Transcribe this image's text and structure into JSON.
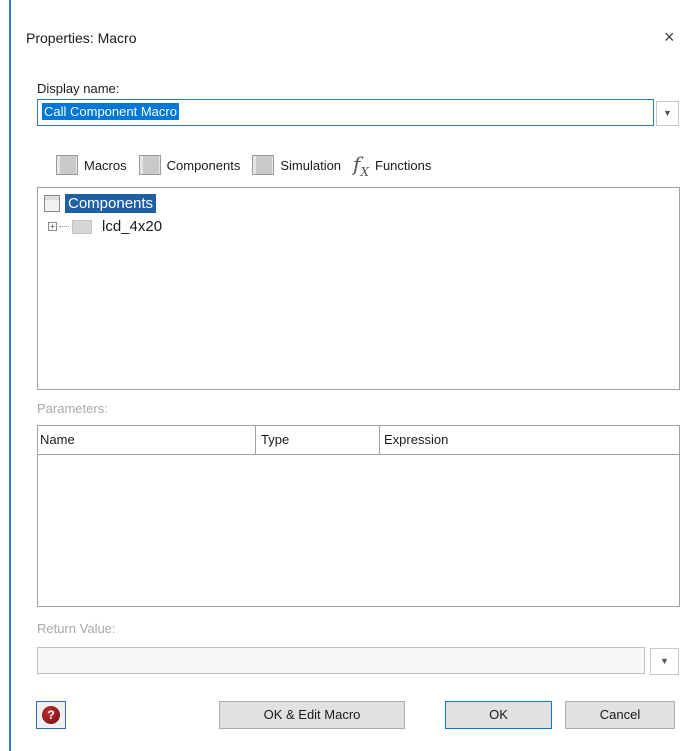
{
  "dialog": {
    "title": "Properties: Macro",
    "close_glyph": "×"
  },
  "display_name": {
    "label": "Display name:",
    "value": "Call Component Macro"
  },
  "tabs": [
    {
      "label": "Macros",
      "icon": "macros-icon"
    },
    {
      "label": "Components",
      "icon": "components-icon"
    },
    {
      "label": "Simulation",
      "icon": "simulation-icon"
    },
    {
      "label": "Functions",
      "icon": "fx-icon"
    }
  ],
  "tree": {
    "root": "Components",
    "children": [
      {
        "label": "lcd_4x20",
        "expander": "+"
      }
    ]
  },
  "parameters": {
    "label": "Parameters:",
    "columns": [
      "Name",
      "Type",
      "Expression"
    ]
  },
  "return_value": {
    "label": "Return Value:",
    "value": ""
  },
  "buttons": {
    "help_glyph": "?",
    "ok_edit": "OK & Edit Macro",
    "ok": "OK",
    "cancel": "Cancel"
  },
  "colors": {
    "accent": "#2b79c2",
    "selection": "#0078d7",
    "tree_selection": "#1f5fa6"
  }
}
